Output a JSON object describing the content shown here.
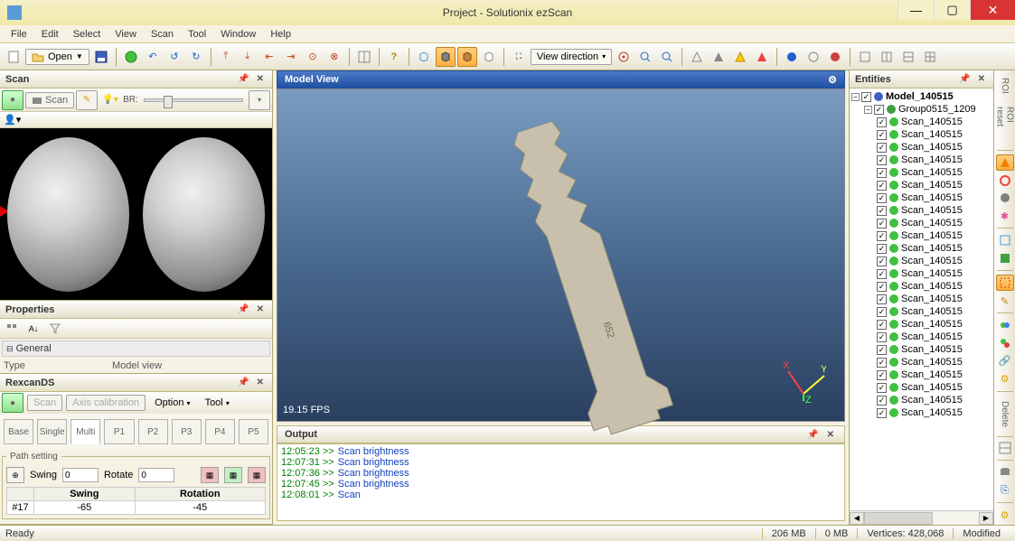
{
  "window": {
    "title": "Project - Solutionix ezScan"
  },
  "menu": [
    "File",
    "Edit",
    "Select",
    "View",
    "Scan",
    "Tool",
    "Window",
    "Help"
  ],
  "toolbar": {
    "open_label": "Open",
    "view_direction_label": "View direction"
  },
  "panels": {
    "scan_title": "Scan",
    "scan_button": "Scan",
    "br_label": "BR:",
    "properties_title": "Properties",
    "general_label": "General",
    "type_label": "Type",
    "type_value": "Model view",
    "rexcan_title": "RexcanDS",
    "rexcan_scan": "Scan",
    "rexcan_axis_calib": "Axis calibration",
    "rexcan_option": "Option",
    "rexcan_tool": "Tool",
    "rexcan_tabs": [
      "Base",
      "Single",
      "Multi",
      "P1",
      "P2",
      "P3",
      "P4",
      "P5"
    ],
    "rexcan_active_tab": "Multi",
    "path_setting_label": "Path setting",
    "swing_label": "Swing",
    "rotate_label": "Rotate",
    "swing_value": "0",
    "rotate_value": "0",
    "path_table_headers": [
      "",
      "Swing",
      "Rotation"
    ],
    "path_table_row": {
      "idx": "#17",
      "swing": "-65",
      "rotation": "-45"
    }
  },
  "modelview": {
    "title": "Model View",
    "fps": "19.15 FPS",
    "axes": {
      "x": "X",
      "y": "Y",
      "z": "Z"
    }
  },
  "output": {
    "title": "Output",
    "lines": [
      {
        "time": "12:05:23 >>",
        "msg": "Scan brightness"
      },
      {
        "time": "12:07:31 >>",
        "msg": "Scan brightness"
      },
      {
        "time": "12:07:36 >>",
        "msg": "Scan brightness"
      },
      {
        "time": "12:07:45 >>",
        "msg": "Scan brightness"
      },
      {
        "time": "12:08:01 >>",
        "msg": "Scan"
      }
    ]
  },
  "entities": {
    "title": "Entities",
    "root": "Model_140515",
    "group": "Group0515_1209",
    "scans": [
      "Scan_140515",
      "Scan_140515",
      "Scan_140515",
      "Scan_140515",
      "Scan_140515",
      "Scan_140515",
      "Scan_140515",
      "Scan_140515",
      "Scan_140515",
      "Scan_140515",
      "Scan_140515",
      "Scan_140515",
      "Scan_140515",
      "Scan_140515",
      "Scan_140515",
      "Scan_140515",
      "Scan_140515",
      "Scan_140515",
      "Scan_140515",
      "Scan_140515",
      "Scan_140515",
      "Scan_140515",
      "Scan_140515",
      "Scan_140515"
    ]
  },
  "toolstrip": {
    "roi_label": "ROI",
    "roi_reset_label": "ROI reset",
    "delete_label": "Delete"
  },
  "status": {
    "ready": "Ready",
    "mem1": "206 MB",
    "mem2": "0 MB",
    "vertices_label": "Vertices:",
    "vertices_value": "428,068",
    "modified": "Modified"
  }
}
